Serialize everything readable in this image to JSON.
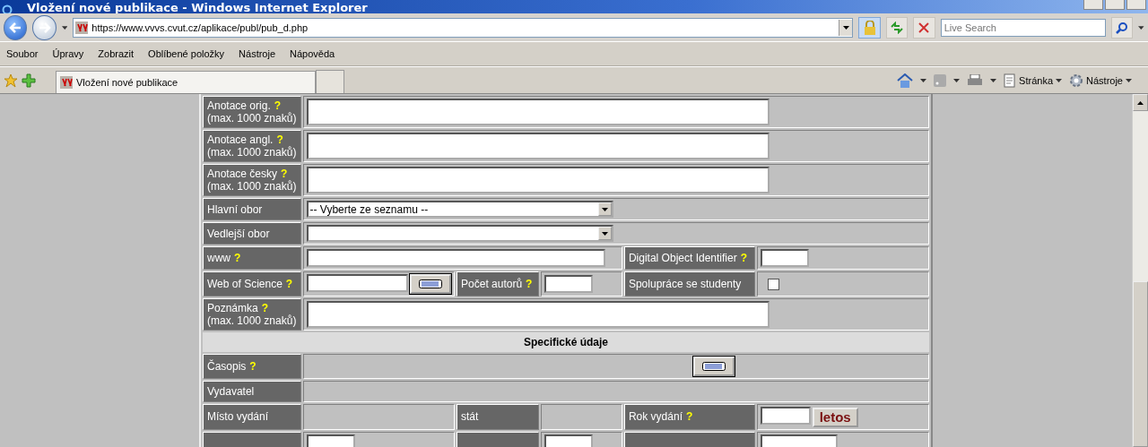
{
  "window": {
    "title": "Vložení nové publikace - Windows Internet Explorer"
  },
  "address_bar": {
    "url": "https://www.vvvs.cvut.cz/aplikace/publ/pub_d.php"
  },
  "search": {
    "placeholder": "Live Search"
  },
  "menu": [
    "Soubor",
    "Úpravy",
    "Zobrazit",
    "Oblíbené položky",
    "Nástroje",
    "Nápověda"
  ],
  "tabs": [
    {
      "label": "Vložení nové publikace",
      "selected": true
    }
  ],
  "command_bar": [
    {
      "label": "Stránka"
    },
    {
      "label": "Nástroje"
    }
  ],
  "form": {
    "rows": [
      {
        "cells": [
          {
            "kind": "label",
            "text": "Anotace orig.",
            "help": "?",
            "note": "(max. 1000 znaků)"
          },
          {
            "kind": "textarea",
            "colspan": 5
          }
        ]
      },
      {
        "cells": [
          {
            "kind": "label",
            "text": "Anotace angl.",
            "help": "?",
            "note": "(max. 1000 znaků)"
          },
          {
            "kind": "textarea",
            "colspan": 5
          }
        ]
      },
      {
        "cells": [
          {
            "kind": "label",
            "text": "Anotace česky",
            "help": "?",
            "note": "(max. 1000 znaků)"
          },
          {
            "kind": "textarea",
            "colspan": 5
          }
        ]
      },
      {
        "cells": [
          {
            "kind": "label",
            "text": "Hlavní obor"
          },
          {
            "kind": "select",
            "value": "-- Vyberte ze seznamu --",
            "colspan": 5
          }
        ]
      },
      {
        "cells": [
          {
            "kind": "label",
            "text": "Vedlejší obor"
          },
          {
            "kind": "select",
            "colspan": 5
          }
        ]
      },
      {
        "cells": [
          {
            "kind": "label",
            "text": "www",
            "help": "?"
          },
          {
            "kind": "input",
            "colspan": 3
          },
          {
            "kind": "label",
            "text": "Digital Object Identifier",
            "help": "?"
          },
          {
            "kind": "input"
          }
        ]
      },
      {
        "cells": [
          {
            "kind": "label",
            "text": "Web of Science",
            "help": "?"
          },
          {
            "kind": "input-lookup"
          },
          {
            "kind": "label",
            "text": "Počet autorů",
            "help": "?"
          },
          {
            "kind": "input"
          },
          {
            "kind": "label",
            "text": "Spolupráce se studenty"
          },
          {
            "kind": "checkbox",
            "checked": false
          }
        ]
      },
      {
        "cells": [
          {
            "kind": "label",
            "text": "Poznámka",
            "help": "?",
            "note": "(max. 1000 znaků)"
          },
          {
            "kind": "textarea",
            "colspan": 5
          }
        ]
      },
      {
        "cells": [
          {
            "kind": "header",
            "text": "Specifické údaje",
            "colspan": 6
          }
        ]
      },
      {
        "cells": [
          {
            "kind": "label",
            "text": "Časopis",
            "help": "?"
          },
          {
            "kind": "lookup",
            "colspan": 5
          }
        ]
      },
      {
        "cells": [
          {
            "kind": "label",
            "text": "Vydavatel"
          },
          {
            "kind": "empty",
            "colspan": 5
          }
        ]
      },
      {
        "cells": [
          {
            "kind": "label",
            "text": "Místo vydání"
          },
          {
            "kind": "empty"
          },
          {
            "kind": "label",
            "text": "stát"
          },
          {
            "kind": "empty"
          },
          {
            "kind": "label",
            "text": "Rok vydání",
            "help": "?"
          },
          {
            "kind": "input-button",
            "button": "letos"
          }
        ]
      },
      {
        "cells": [
          {
            "kind": "blank-label"
          },
          {
            "kind": "input"
          },
          {
            "kind": "blank-label"
          },
          {
            "kind": "input"
          },
          {
            "kind": "blank-label"
          },
          {
            "kind": "input"
          }
        ]
      }
    ]
  }
}
